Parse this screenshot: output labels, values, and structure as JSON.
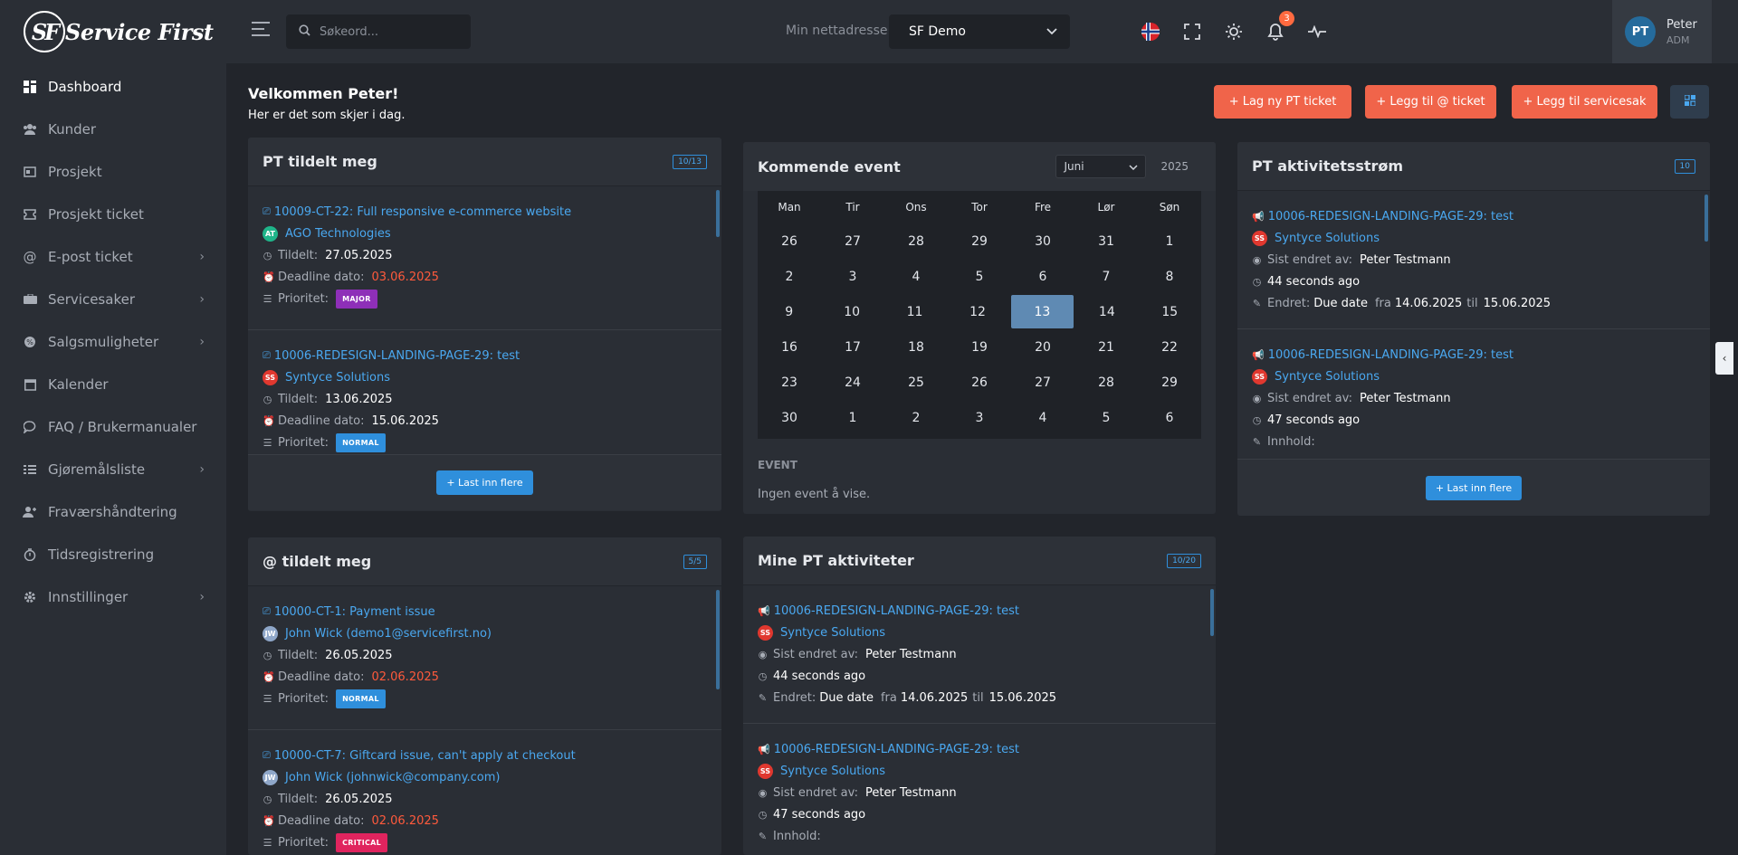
{
  "brand": {
    "mark": "SF",
    "name": "Service First"
  },
  "sidebar": {
    "items": [
      {
        "label": "Dashboard",
        "icon": "dashboard-icon",
        "active": true,
        "chevron": false
      },
      {
        "label": "Kunder",
        "icon": "users-icon",
        "chevron": false
      },
      {
        "label": "Prosjekt",
        "icon": "project-icon",
        "chevron": false
      },
      {
        "label": "Prosjekt ticket",
        "icon": "ticket-icon",
        "chevron": false
      },
      {
        "label": "E-post ticket",
        "icon": "at-icon",
        "chevron": true
      },
      {
        "label": "Servicesaker",
        "icon": "service-icon",
        "chevron": true
      },
      {
        "label": "Salgsmuligheter",
        "icon": "sales-icon",
        "chevron": true
      },
      {
        "label": "Kalender",
        "icon": "calendar-icon",
        "chevron": false
      },
      {
        "label": "FAQ / Brukermanualer",
        "icon": "faq-icon",
        "chevron": false
      },
      {
        "label": "Gjøremålsliste",
        "icon": "todo-icon",
        "chevron": true
      },
      {
        "label": "Fraværshåndtering",
        "icon": "absence-icon",
        "chevron": false
      },
      {
        "label": "Tidsregistrering",
        "icon": "timer-icon",
        "chevron": false
      },
      {
        "label": "Innstillinger",
        "icon": "settings-icon",
        "chevron": true
      }
    ]
  },
  "topbar": {
    "search_placeholder": "Søkeord...",
    "site_label": "Min nettadresse",
    "site_value": "SF Demo",
    "notif_count": "3",
    "user_initials": "PT",
    "user_name": "Peter",
    "user_role": "ADM"
  },
  "welcome": {
    "title": "Velkommen Peter!",
    "subtitle": "Her er det som skjer i dag."
  },
  "actions": {
    "new_pt": "+ Lag ny PT ticket",
    "add_at": "+ Legg til @ ticket",
    "add_service": "+ Legg til servicesak"
  },
  "pt_assigned": {
    "title": "PT tildelt meg",
    "badge": "10/13",
    "load_more": "+ Last inn flere",
    "items": [
      {
        "ticket": "10009-CT-22: Full responsive e-commerce website",
        "customer": "AGO Technologies",
        "avatar": "AT",
        "avatar_color": "#1fb58a",
        "assigned_label": "Tildelt:",
        "assigned": "27.05.2025",
        "deadline_label": "Deadline dato:",
        "deadline": "03.06.2025",
        "priority_label": "Prioritet:",
        "priority": "MAJOR",
        "priority_color": "#8e2fb8"
      },
      {
        "ticket": "10006-REDESIGN-LANDING-PAGE-29: test",
        "customer": "Syntyce Solutions",
        "avatar": "SS",
        "avatar_color": "#e0382f",
        "assigned_label": "Tildelt:",
        "assigned": "13.06.2025",
        "deadline_label": "Deadline dato:",
        "deadline": "15.06.2025",
        "priority_label": "Prioritet:",
        "priority": "NORMAL",
        "priority_color": "#2f8fdc"
      }
    ]
  },
  "at_assigned": {
    "title": "@ tildelt meg",
    "badge": "5/5",
    "items": [
      {
        "ticket": "10000-CT-1: Payment issue",
        "customer": "John Wick (demo1@servicefirst.no)",
        "avatar": "JW",
        "avatar_color": "#8fa7c9",
        "assigned_label": "Tildelt:",
        "assigned": "26.05.2025",
        "deadline_label": "Deadline dato:",
        "deadline": "02.06.2025",
        "priority_label": "Prioritet:",
        "priority": "NORMAL",
        "priority_color": "#2f8fdc"
      },
      {
        "ticket": "10000-CT-7: Giftcard issue, can't apply at checkout",
        "customer": "John Wick (johnwick@company.com)",
        "avatar": "JW",
        "avatar_color": "#8fa7c9",
        "assigned_label": "Tildelt:",
        "assigned": "26.05.2025",
        "deadline_label": "Deadline dato:",
        "deadline": "02.06.2025",
        "priority_label": "Prioritet:",
        "priority": "CRITICAL",
        "priority_color": "#e0245e"
      }
    ]
  },
  "calendar": {
    "title": "Kommende event",
    "month": "Juni",
    "year": "2025",
    "weekdays": [
      "Man",
      "Tir",
      "Ons",
      "Tor",
      "Fre",
      "Lør",
      "Søn"
    ],
    "weeks": [
      [
        "26",
        "27",
        "28",
        "29",
        "30",
        "31",
        "1"
      ],
      [
        "2",
        "3",
        "4",
        "5",
        "6",
        "7",
        "8"
      ],
      [
        "9",
        "10",
        "11",
        "12",
        "13",
        "14",
        "15"
      ],
      [
        "16",
        "17",
        "18",
        "19",
        "20",
        "21",
        "22"
      ],
      [
        "23",
        "24",
        "25",
        "26",
        "27",
        "28",
        "29"
      ],
      [
        "30",
        "1",
        "2",
        "3",
        "4",
        "5",
        "6"
      ]
    ],
    "today": "13",
    "event_label": "EVENT",
    "event_empty": "Ingen event å vise."
  },
  "my_pt_activities": {
    "title": "Mine PT aktiviteter",
    "badge": "10/20",
    "items": [
      {
        "ticket": "10006-REDESIGN-LANDING-PAGE-29: test",
        "customer": "Syntyce Solutions",
        "avatar": "SS",
        "changed_by_label": "Sist endret av:",
        "changed_by": "Peter Testmann",
        "time": "44 seconds ago",
        "change_label": "Endret:",
        "change_field": "Due date",
        "from_label": "fra",
        "from": "14.06.2025",
        "to_label": "til",
        "to": "15.06.2025"
      },
      {
        "ticket": "10006-REDESIGN-LANDING-PAGE-29: test",
        "customer": "Syntyce Solutions",
        "avatar": "SS",
        "changed_by_label": "Sist endret av:",
        "changed_by": "Peter Testmann",
        "time": "47 seconds ago",
        "content_label": "Innhold:"
      }
    ]
  },
  "pt_stream": {
    "title": "PT aktivitetsstrøm",
    "badge": "10",
    "load_more": "+ Last inn flere",
    "items": [
      {
        "ticket": "10006-REDESIGN-LANDING-PAGE-29: test",
        "customer": "Syntyce Solutions",
        "avatar": "SS",
        "changed_by_label": "Sist endret av:",
        "changed_by": "Peter Testmann",
        "time": "44 seconds ago",
        "change_label": "Endret:",
        "change_field": "Due date",
        "from_label": "fra",
        "from": "14.06.2025",
        "to_label": "til",
        "to": "15.06.2025"
      },
      {
        "ticket": "10006-REDESIGN-LANDING-PAGE-29: test",
        "customer": "Syntyce Solutions",
        "avatar": "SS",
        "changed_by_label": "Sist endret av:",
        "changed_by": "Peter Testmann",
        "time": "47 seconds ago",
        "content_label": "Innhold:"
      }
    ]
  },
  "colors": {
    "accent": "#f0644a",
    "link": "#4aa8f0",
    "deadline": "#ff5a3c"
  }
}
